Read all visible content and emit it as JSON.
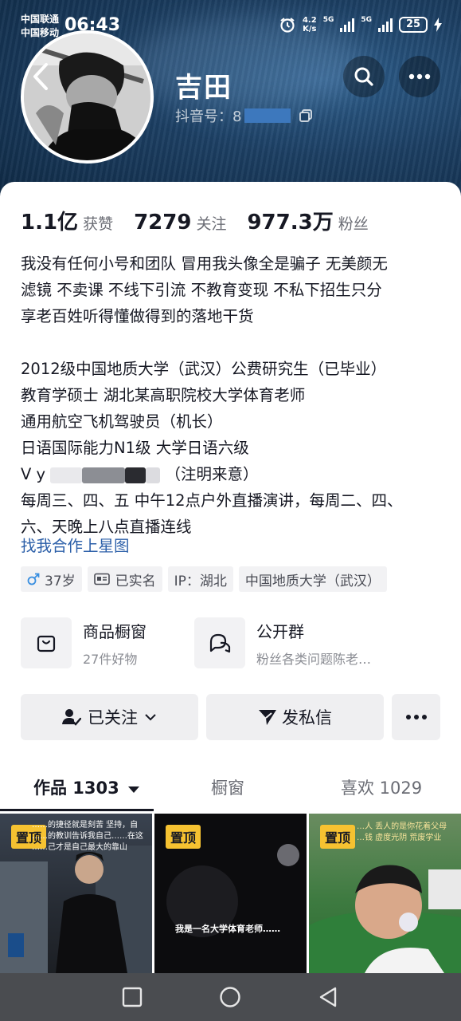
{
  "status_bar": {
    "carrier_1": "中国联通",
    "carrier_2": "中国移动",
    "time": "06:43",
    "speed_value": "4.2",
    "speed_unit": "K/s",
    "net_1": "5G",
    "net_2": "5G",
    "battery": "25"
  },
  "profile": {
    "name": "吉田",
    "douyin_id_label": "抖音号：8",
    "douyin_id_tail": "8"
  },
  "stats": [
    {
      "value": "1.1亿",
      "label": "获赞"
    },
    {
      "value": "7279",
      "label": "关注"
    },
    {
      "value": "977.3万",
      "label": "粉丝"
    }
  ],
  "bio": {
    "line1": "我没有任何小号和团队 冒用我头像全是骗子 无美颜无",
    "line2": "滤镜 不卖课 不线下引流 不教育变现 不私下招生只分",
    "line3": "享老百姓听得懂做得到的落地干货",
    "line4": "2012级中国地质大学（武汉）公费研究生（已毕业）",
    "line5": "教育学硕士 湖北某高职院校大学体育老师",
    "line6": "通用航空飞机驾驶员（机长）",
    "line7": "日语国际能力N1级 大学日语六级",
    "line8_prefix": "V  y",
    "line8_suffix": "（注明来意）",
    "line9": "每周三、四、五 中午12点户外直播演讲，每周二、四、",
    "line10": "六、天晚上八点直播连线"
  },
  "star_link": "找我合作上星图",
  "tags": {
    "age": "37岁",
    "verified": "已实名",
    "ip": "IP：湖北",
    "school": "中国地质大学（武汉）"
  },
  "shop": {
    "title": "商品橱窗",
    "sub": "27件好物"
  },
  "group": {
    "title": "公开群",
    "sub": "粉丝各类问题陈老…"
  },
  "actions": {
    "follow": "已关注",
    "message": "发私信"
  },
  "tabs": {
    "works": "作品 1303",
    "window": "橱窗",
    "likes": "喜欢 1029"
  },
  "videos": {
    "pin_label": "置顶",
    "v1_cap1": "……的捷径就是刻苦   坚持，自",
    "v1_cap2": "……的教训告诉我自己……在这",
    "v1_cap3": "……己才是自己最大的靠山",
    "v2_cap": "我是一名大学体育老师……",
    "v3_cap1": "…人 丢人的是你花着父母",
    "v3_cap2": "…钱 虚度光阴 荒废学业"
  },
  "colors": {
    "accent_link": "#2a5ea8",
    "pin_bg": "#f6c231",
    "hero_bg": "#1c3f63"
  }
}
